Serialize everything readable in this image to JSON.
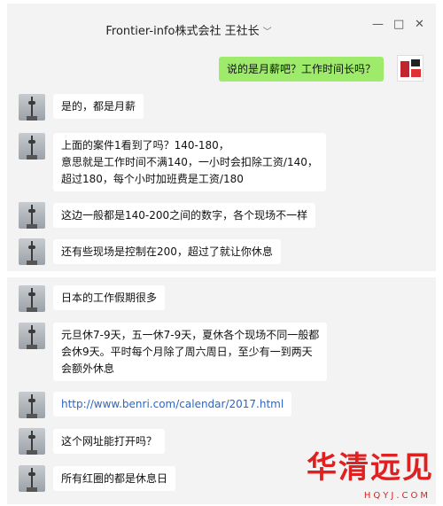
{
  "window": {
    "title": "Frontier-info株式会社 王社长",
    "dropdown_glyph": "﹀",
    "minimize_glyph": "—",
    "maximize_glyph": "□",
    "close_glyph": "✕"
  },
  "messages_top": [
    {
      "from": "self",
      "text": "说的是月薪吧？工作时间长吗？"
    },
    {
      "from": "other",
      "text": "是的，都是月薪"
    },
    {
      "from": "other",
      "lines": [
        "上面的案件1看到了吗？140-180，",
        "意思就是工作时间不满140，一小时会扣除工资/140，",
        "超过180，每个小时加班费是工资/180"
      ]
    },
    {
      "from": "other",
      "text": "这边一般都是140-200之间的数字，各个现场不一样"
    },
    {
      "from": "other",
      "text": "还有些现场是控制在200，超过了就让你休息"
    }
  ],
  "messages_bottom": [
    {
      "from": "other",
      "text": "日本的工作假期很多"
    },
    {
      "from": "other",
      "lines": [
        "元旦休7-9天，五一休7-9天，夏休各个现场不同一般都",
        "会休9天。平时每个月除了周六周日，至少有一到两天",
        "会额外休息"
      ]
    },
    {
      "from": "other",
      "text": "http://www.benri.com/calendar/2017.html"
    },
    {
      "from": "other",
      "text": "这个网址能打开吗？"
    },
    {
      "from": "other",
      "text": "所有红圈的都是休息日"
    }
  ],
  "watermark": {
    "main": "华清远见",
    "sub": "HQYJ.COM"
  }
}
